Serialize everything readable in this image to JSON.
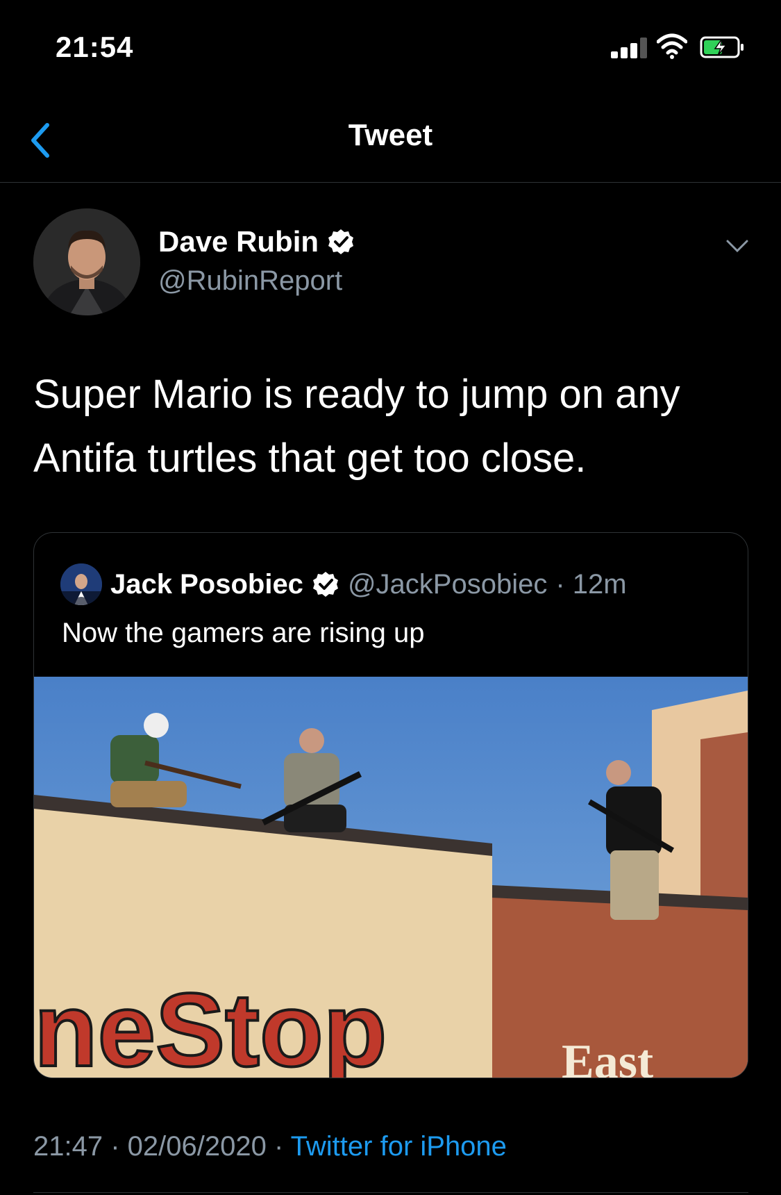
{
  "status_bar": {
    "time": "21:54"
  },
  "nav": {
    "title": "Tweet"
  },
  "tweet": {
    "author_name": "Dave Rubin",
    "author_handle": "@RubinReport",
    "text": "Super Mario is ready to jump on any Antifa turtles that get too close.",
    "timestamp": "21:47 · 02/06/2020 · ",
    "source": "Twitter for iPhone"
  },
  "quote": {
    "author_name": "Jack Posobiec",
    "author_handle": "@JackPosobiec",
    "time_ago": "· 12m",
    "text": "Now the gamers are rising up",
    "sign_text_left": "neStop",
    "sign_text_right": "East"
  },
  "colors": {
    "accent": "#1d9bf0",
    "secondary_text": "#8b98a5",
    "background": "#000000",
    "sky": "#4f86cc"
  },
  "icons": [
    "back-chevron-icon",
    "verified-badge-icon",
    "chevron-down-icon",
    "signal-icon",
    "wifi-icon",
    "battery-charging-icon"
  ]
}
